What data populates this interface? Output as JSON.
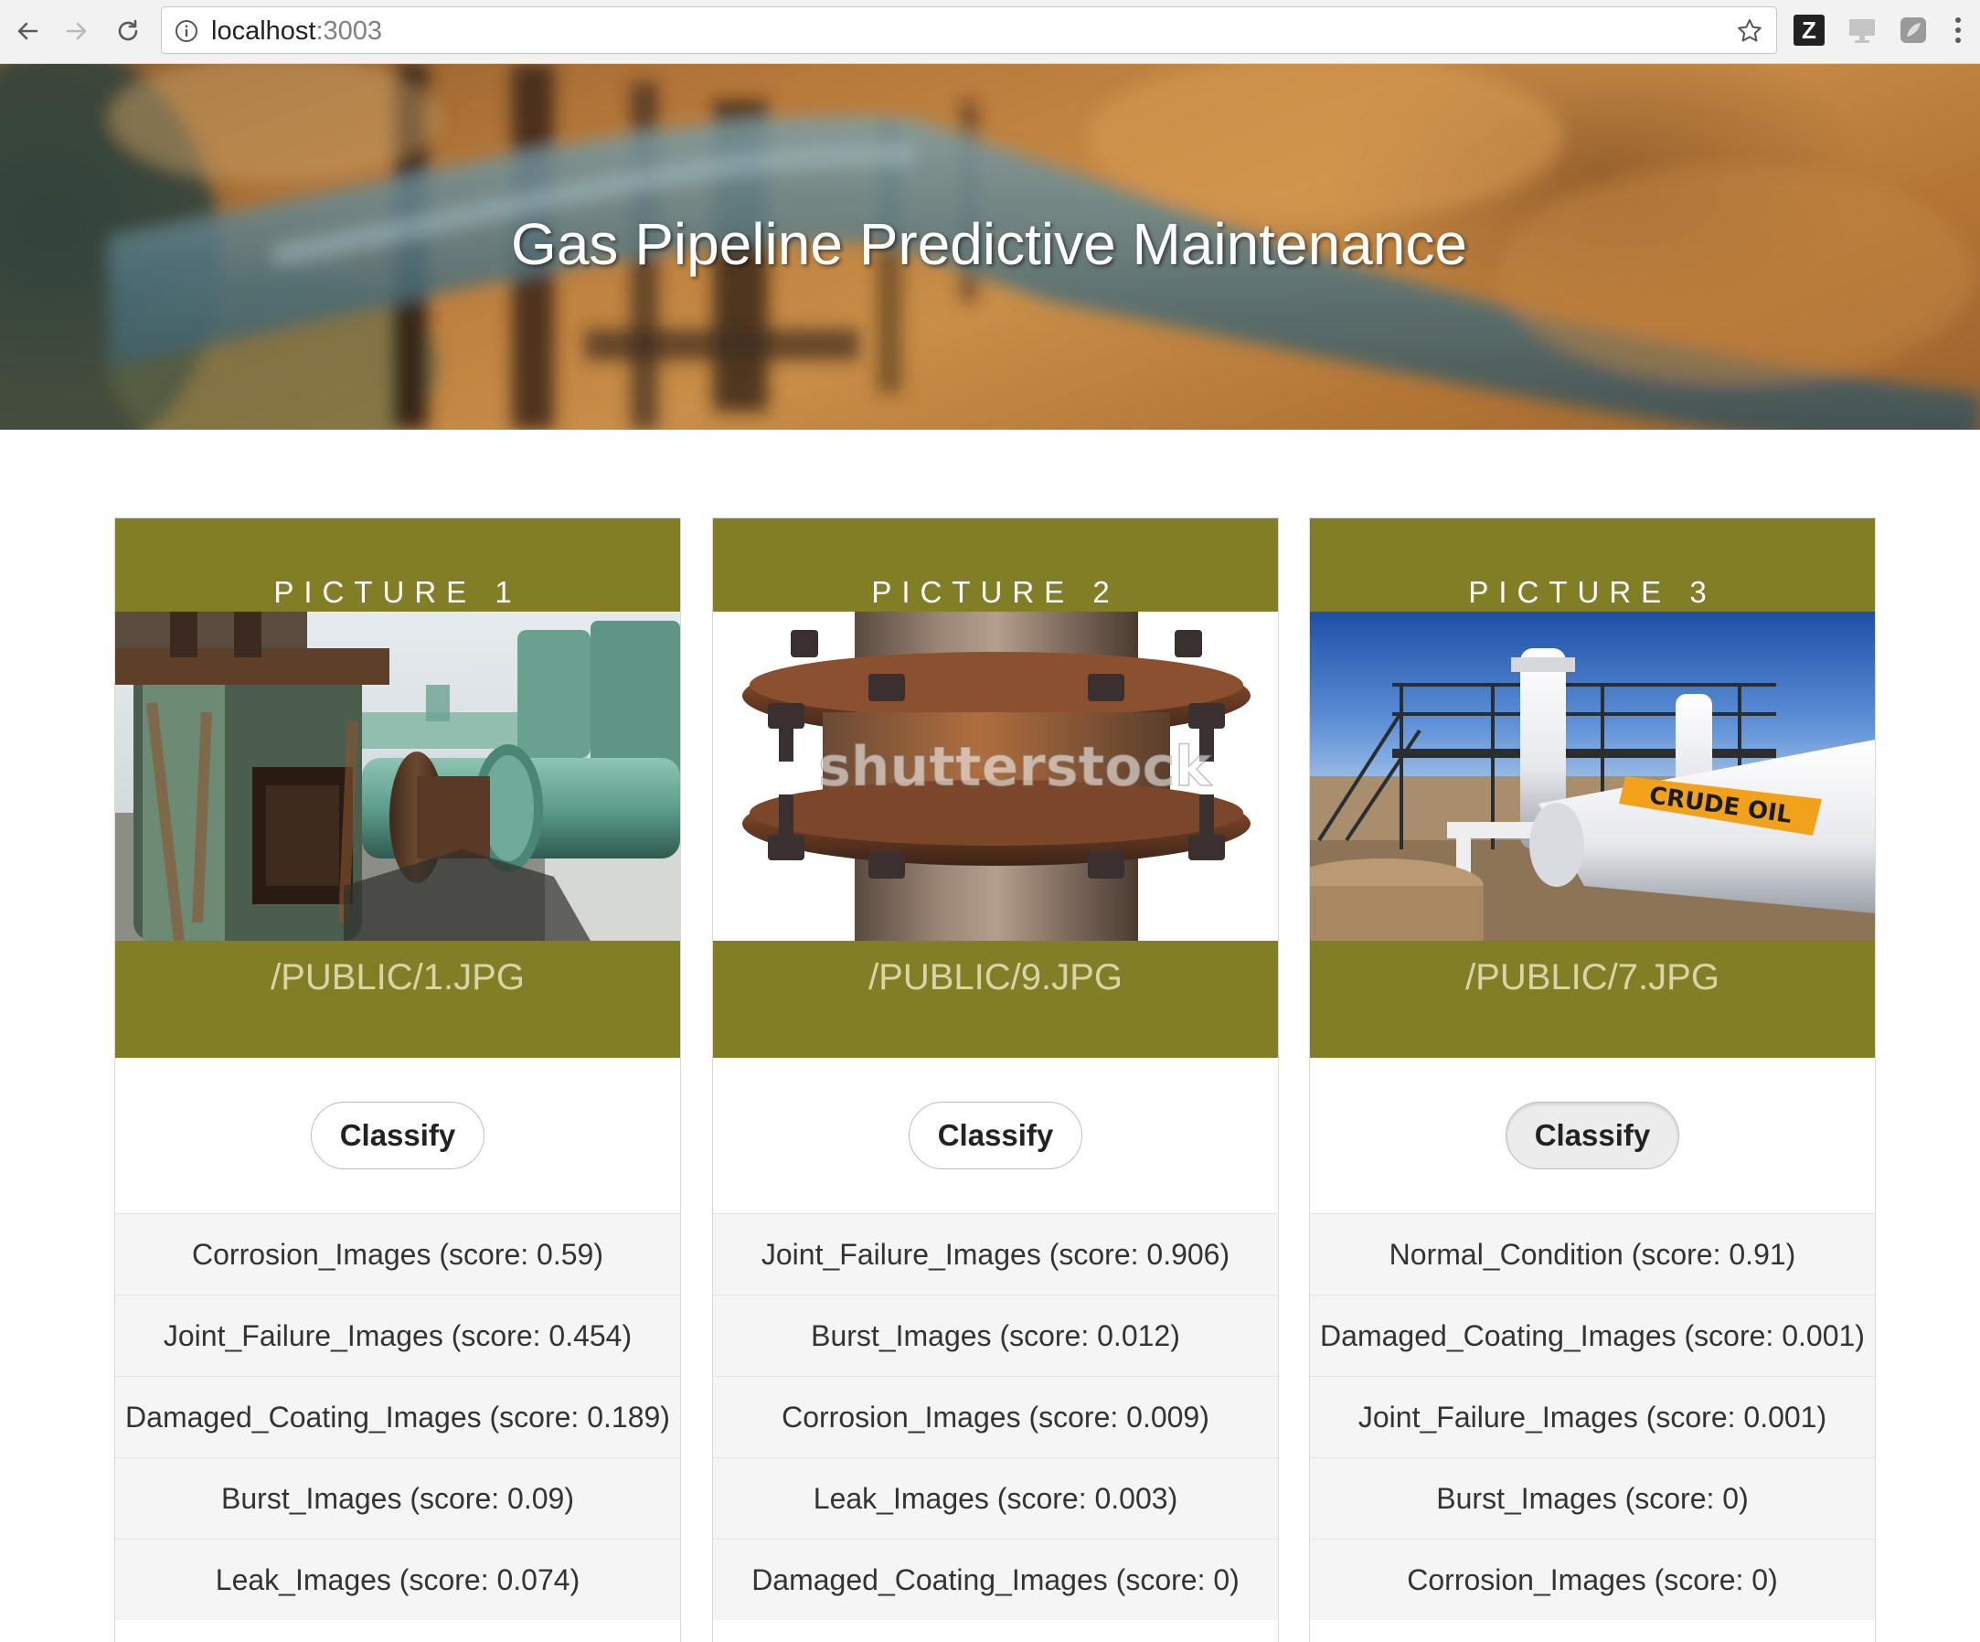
{
  "browser": {
    "url_host": "localhost",
    "url_port": ":3003",
    "extension_z_label": "Z",
    "icons": [
      "back-arrow-icon",
      "forward-arrow-icon",
      "reload-icon",
      "info-icon",
      "bookmark-star-icon",
      "zotero-icon",
      "cast-icon",
      "extension-icon",
      "more-menu-icon"
    ]
  },
  "hero": {
    "title": "Gas Pipeline Predictive Maintenance"
  },
  "theme": {
    "accent": "#827e26",
    "path_text": "#d8d6a8"
  },
  "cards": [
    {
      "title": "PICTURE 1",
      "path": "/PUBLIC/1.JPG",
      "button_label": "Classify",
      "results": [
        "Corrosion_Images (score: 0.59)",
        "Joint_Failure_Images (score: 0.454)",
        "Damaged_Coating_Images (score: 0.189)",
        "Burst_Images (score: 0.09)",
        "Leak_Images (score: 0.074)"
      ]
    },
    {
      "title": "PICTURE 2",
      "path": "/PUBLIC/9.JPG",
      "button_label": "Classify",
      "results": [
        "Joint_Failure_Images (score: 0.906)",
        "Burst_Images (score: 0.012)",
        "Corrosion_Images (score: 0.009)",
        "Leak_Images (score: 0.003)",
        "Damaged_Coating_Images (score: 0)"
      ]
    },
    {
      "title": "PICTURE 3",
      "path": "/PUBLIC/7.JPG",
      "button_label": "Classify",
      "results": [
        "Normal_Condition (score: 0.91)",
        "Damaged_Coating_Images (score: 0.001)",
        "Joint_Failure_Images (score: 0.001)",
        "Burst_Images (score: 0)",
        "Corrosion_Images (score: 0)"
      ]
    }
  ],
  "image_text": {
    "watermark": "shutterstock",
    "pipe_label": "CRUDE OIL"
  }
}
